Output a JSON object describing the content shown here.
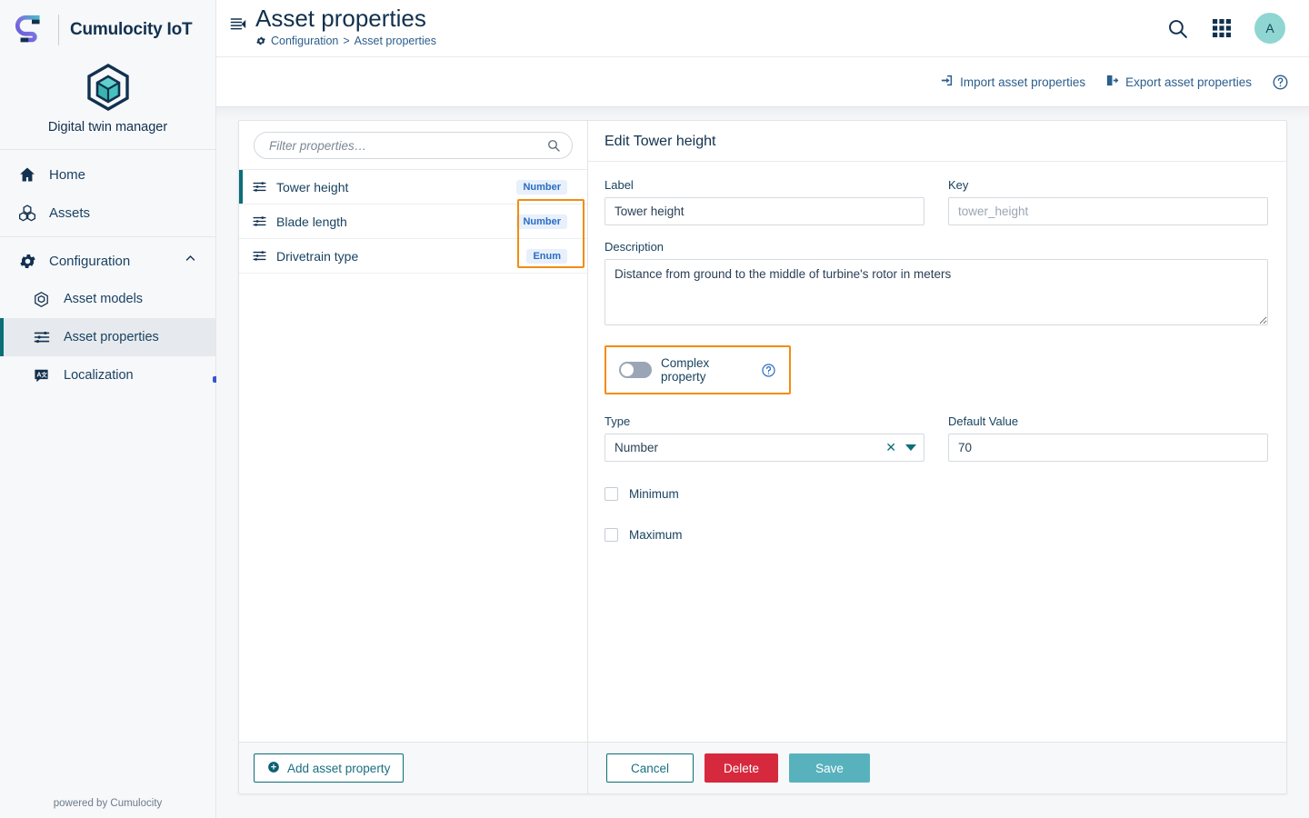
{
  "sidebar": {
    "brand_name": "Cumulocity IoT",
    "brand_logo_icon": "cumulocity-s-logo",
    "app_icon": "cube-hexagon-icon",
    "app_name": "Digital twin manager",
    "items": [
      {
        "label": "Home",
        "icon": "home-icon"
      },
      {
        "label": "Assets",
        "icon": "assets-cubes-icon"
      },
      {
        "label": "Configuration",
        "icon": "gear-icon",
        "chevron": "chevron-up-icon"
      }
    ],
    "sub_items": [
      {
        "label": "Asset models",
        "icon": "cube-outline-icon",
        "active": false
      },
      {
        "label": "Asset properties",
        "icon": "sliders-icon",
        "active": true
      },
      {
        "label": "Localization",
        "icon": "translate-icon",
        "active": false
      }
    ],
    "powered_by": "powered by Cumulocity"
  },
  "header": {
    "menu_icon": "list-collapse-icon",
    "title": "Asset properties",
    "breadcrumb": {
      "gear_icon": "gear-icon",
      "root": "Configuration",
      "separator": ">",
      "current": "Asset properties"
    },
    "search_icon": "search-icon",
    "apps_icon": "app-grid-icon",
    "avatar_initial": "A"
  },
  "actionbar": {
    "import_label": "Import asset properties",
    "import_icon": "import-icon",
    "export_label": "Export asset properties",
    "export_icon": "export-icon",
    "help_icon": "help-circle-icon"
  },
  "list_pane": {
    "filter_placeholder": "Filter properties…",
    "filter_value": "",
    "search_icon": "search-icon",
    "properties": [
      {
        "name": "Tower height",
        "badge": "Number",
        "icon": "sliders-icon",
        "selected": true
      },
      {
        "name": "Blade length",
        "badge": "Number",
        "icon": "sliders-icon",
        "selected": false
      },
      {
        "name": "Drivetrain type",
        "badge": "Enum",
        "icon": "sliders-icon",
        "selected": false
      }
    ],
    "add_button": "Add asset property",
    "add_icon": "plus-circle-icon"
  },
  "edit_pane": {
    "title": "Edit Tower height",
    "label_field": {
      "label": "Label",
      "value": "Tower height"
    },
    "key_field": {
      "label": "Key",
      "value": "",
      "placeholder": "tower_height"
    },
    "description_field": {
      "label": "Description",
      "value": "Distance from ground to the middle of turbine's rotor in meters"
    },
    "complex_property": {
      "label": "Complex property",
      "enabled": false,
      "help_icon": "help-circle-icon"
    },
    "type_field": {
      "label": "Type",
      "value": "Number",
      "clear_icon": "clear-x-icon",
      "caret_icon": "chevron-down-icon"
    },
    "default_value_field": {
      "label": "Default Value",
      "value": "70"
    },
    "minimum_checkbox": {
      "label": "Minimum",
      "checked": false
    },
    "maximum_checkbox": {
      "label": "Maximum",
      "checked": false
    },
    "cancel_button": "Cancel",
    "delete_button": "Delete",
    "save_button": "Save"
  },
  "colors": {
    "brand_dark": "#12314f",
    "teal": "#0b6e78",
    "accent_teal": "#57b2bd",
    "danger": "#d6293e",
    "highlight_orange": "#f18d11",
    "badge_bg": "#e7f0fb",
    "badge_text": "#2b6cc4",
    "link_blue": "#2b5e8c"
  }
}
